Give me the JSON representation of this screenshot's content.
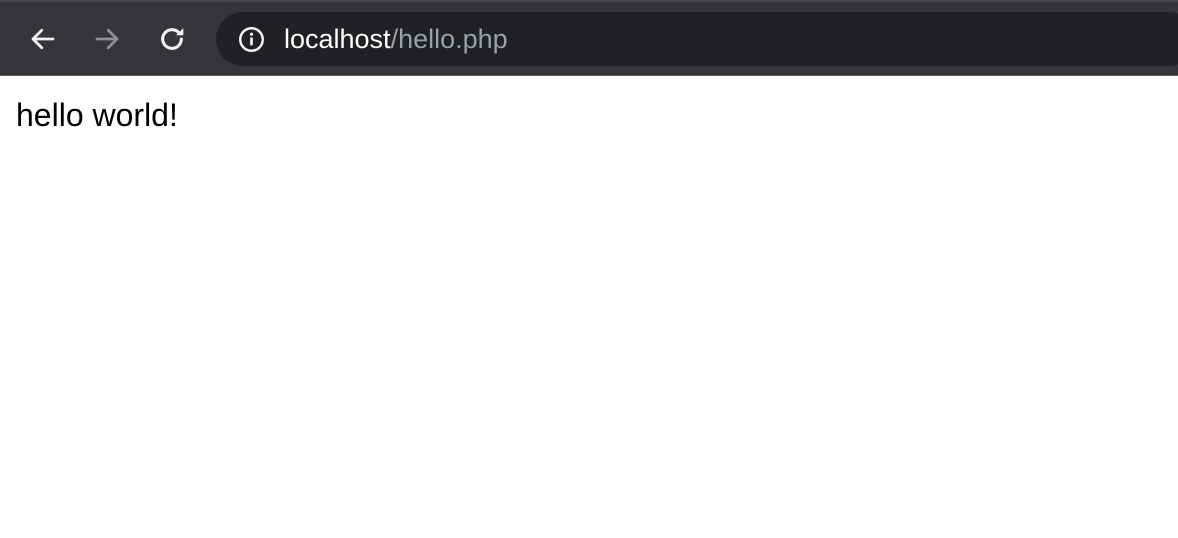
{
  "browser": {
    "address": {
      "host": "localhost",
      "path": "/hello.php"
    },
    "icons": {
      "back": "arrow-left-icon",
      "forward": "arrow-right-icon",
      "reload": "reload-icon",
      "site_info": "info-icon"
    },
    "colors": {
      "toolbar": "#35363a",
      "omnibox": "#202124",
      "host_text": "#ffffff",
      "path_text": "#9aa0a6",
      "disabled_icon": "#8e8f93"
    }
  },
  "page": {
    "text": "hello world!"
  }
}
